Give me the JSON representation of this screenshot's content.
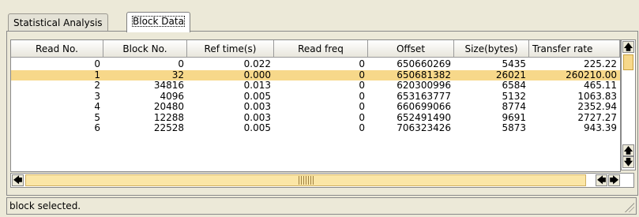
{
  "tabs": [
    {
      "label": "Statistical Analysis"
    },
    {
      "label": "Block Data"
    }
  ],
  "table": {
    "columns": [
      "Read No.",
      "Block No.",
      "Ref time(s)",
      "Read freq",
      "Offset",
      "Size(bytes)",
      "Transfer rate"
    ],
    "rows": [
      [
        "0",
        "0",
        "0.022",
        "0",
        "650660269",
        "5435",
        "225.22"
      ],
      [
        "1",
        "32",
        "0.000",
        "0",
        "650681382",
        "26021",
        "260210.00"
      ],
      [
        "2",
        "34816",
        "0.013",
        "0",
        "620300996",
        "6584",
        "465.11"
      ],
      [
        "3",
        "4096",
        "0.005",
        "0",
        "653163777",
        "5132",
        "1063.83"
      ],
      [
        "4",
        "20480",
        "0.003",
        "0",
        "660699066",
        "8774",
        "2352.94"
      ],
      [
        "5",
        "12288",
        "0.003",
        "0",
        "652491490",
        "9691",
        "2727.27"
      ],
      [
        "6",
        "22528",
        "0.005",
        "0",
        "706323426",
        "5873",
        "943.39"
      ]
    ],
    "selected_row": 1
  },
  "status": {
    "text": "block selected."
  },
  "colors": {
    "selection": "#f7d88a",
    "scrollbar": "#fbe6a6"
  }
}
